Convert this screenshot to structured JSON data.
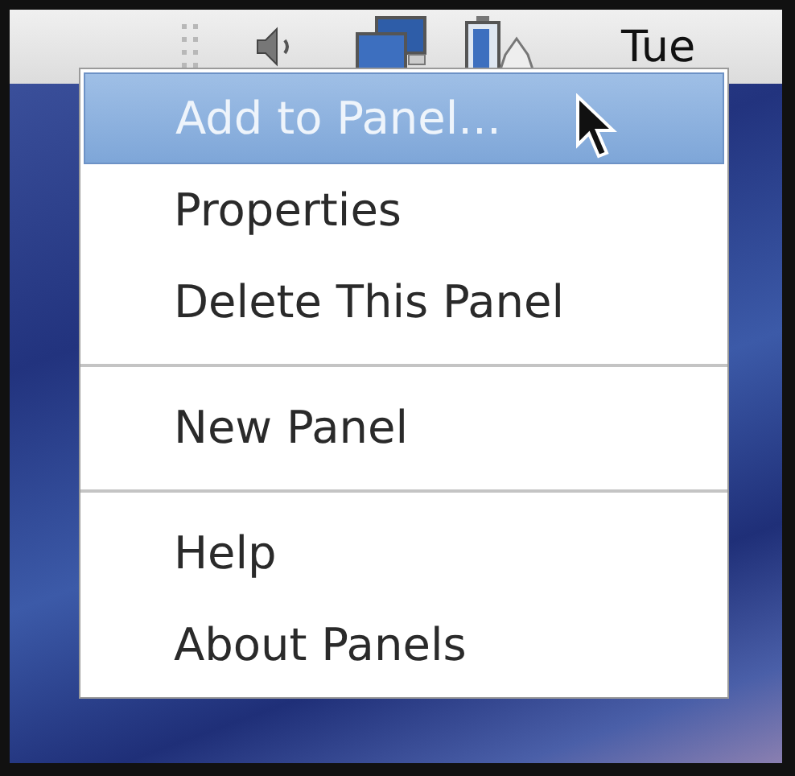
{
  "panel": {
    "clock_text": "Tue"
  },
  "menu": {
    "items": [
      {
        "kind": "item",
        "label": "Add to Panel...",
        "selected": true
      },
      {
        "kind": "item",
        "label": "Properties",
        "selected": false
      },
      {
        "kind": "item",
        "label": "Delete This Panel",
        "selected": false
      },
      {
        "kind": "separator"
      },
      {
        "kind": "item",
        "label": "New Panel",
        "selected": false
      },
      {
        "kind": "separator"
      },
      {
        "kind": "item",
        "label": "Help",
        "selected": false
      },
      {
        "kind": "item",
        "label": "About Panels",
        "selected": false
      }
    ]
  }
}
